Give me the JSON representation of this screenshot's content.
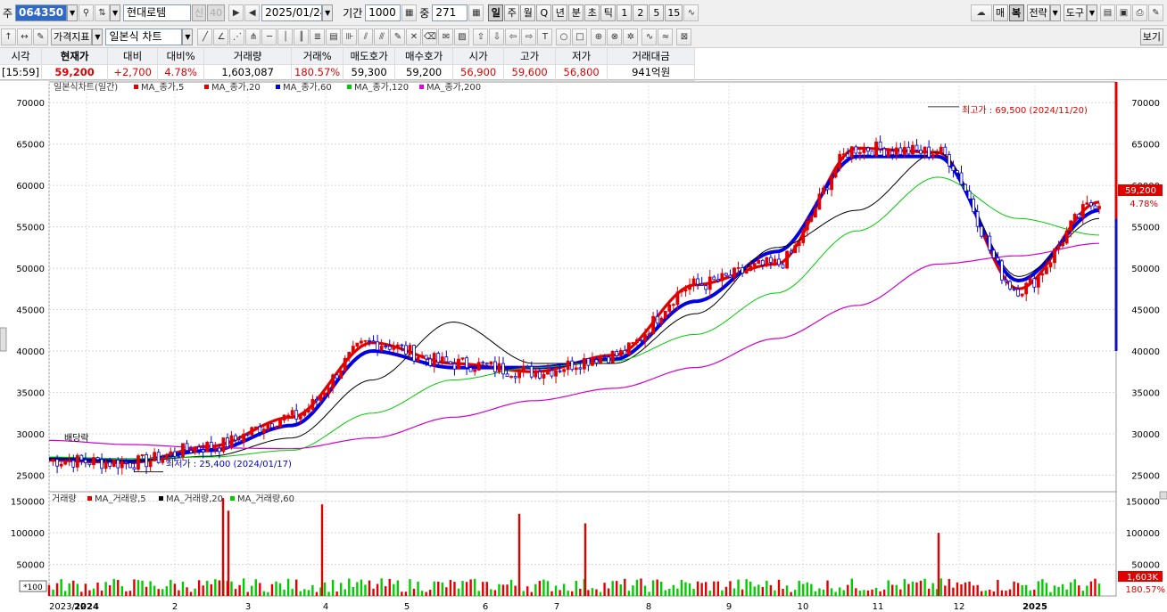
{
  "toolbar1": {
    "market_label": "주",
    "stock_code": "064350",
    "stock_name": "현대로템",
    "badge_credit": "신",
    "badge_ratio": "40",
    "date": "2025/01/24",
    "period_label": "기간",
    "period_value": "1000",
    "overlap_label": "중",
    "overlap_value": "271",
    "timeframes": [
      "일",
      "주",
      "월",
      "Q",
      "년",
      "분",
      "초",
      "틱",
      "1",
      "2",
      "5",
      "15"
    ],
    "active_timeframe": "일",
    "right_buttons": [
      "매",
      "복",
      "전략",
      "도구"
    ]
  },
  "toolbar2": {
    "time_label": "시각",
    "indicator_label": "가격지표",
    "chart_type": "일본식 차트",
    "view_label": "보기"
  },
  "quote": {
    "headers": [
      "시각",
      "현재가",
      "대비",
      "대비%",
      "거래량",
      "거래%",
      "매도호가",
      "매수호가",
      "시가",
      "고가",
      "저가",
      "거래대금"
    ],
    "values": [
      "[15:59]",
      "59,200",
      "+2,700",
      "4.78%",
      "1,603,087",
      "180.57%",
      "59,300",
      "59,200",
      "56,900",
      "59,600",
      "56,800",
      "941억원"
    ]
  },
  "price_panel": {
    "legend_title": "일본식차트(일간)",
    "legend_items": [
      "MA_종가,5",
      "MA_종가,20",
      "MA_종가,60",
      "MA_종가,120",
      "MA_종가,200"
    ],
    "legend_colors": [
      "#e00000",
      "#e00000",
      "#0000e0",
      "#00cc00",
      "#e000e0"
    ],
    "y_ticks": [
      "70000",
      "65000",
      "60000",
      "55000",
      "50000",
      "45000",
      "40000",
      "35000",
      "30000",
      "25000"
    ],
    "high_annotation": "최고가 : 69,500 (2024/11/20)",
    "low_annotation": "최저가 : 25,400 (2024/01/17)",
    "dividend_label": "배당락",
    "last_price_label": "59,200",
    "last_change_label": "4.78%"
  },
  "volume_panel": {
    "legend_title": "거래량",
    "legend_items": [
      "MA_거래량,5",
      "MA_거래량,20",
      "MA_거래량,60"
    ],
    "y_ticks": [
      "150000",
      "100000",
      "50000"
    ],
    "unit_label": "*100",
    "last_volume_label": "1,603K",
    "last_volume_pct": "180.57%"
  },
  "x_axis": {
    "labels": [
      "2023/12",
      "2024",
      "2",
      "3",
      "4",
      "5",
      "6",
      "7",
      "8",
      "9",
      "10",
      "11",
      "12",
      "2025"
    ]
  },
  "chart_data": {
    "type": "candlestick",
    "title": "일본식차트(일간)",
    "x": [
      "2023/12",
      "2024/01",
      "2024/02",
      "2024/03",
      "2024/04",
      "2024/05",
      "2024/06",
      "2024/07",
      "2024/08",
      "2024/09",
      "2024/10",
      "2024/11",
      "2024/12",
      "2025/01"
    ],
    "ylim": [
      23000,
      72500
    ],
    "series": [
      {
        "name": "MA_종가,5",
        "values": [
          26800,
          26500,
          28500,
          32000,
          41000,
          38500,
          37500,
          39500,
          48000,
          50500,
          64500,
          64000,
          47500,
          58000
        ]
      },
      {
        "name": "MA_종가,20",
        "values": [
          27000,
          26700,
          28000,
          31000,
          40000,
          38000,
          38000,
          39000,
          46000,
          52000,
          63500,
          63500,
          48500,
          57000
        ]
      },
      {
        "name": "MA_종가,60",
        "values": [
          27000,
          26700,
          27300,
          29500,
          36500,
          43500,
          38500,
          38500,
          44500,
          52500,
          57000,
          64000,
          49000,
          56000
        ]
      },
      {
        "name": "MA_종가,120",
        "values": [
          27200,
          27000,
          27200,
          28000,
          32500,
          36500,
          38000,
          38800,
          42000,
          47000,
          54500,
          61000,
          56000,
          54000
        ]
      },
      {
        "name": "MA_종가,200",
        "values": [
          29200,
          28700,
          28300,
          28200,
          29500,
          32000,
          34000,
          35500,
          38000,
          41500,
          45500,
          50500,
          51500,
          53000
        ]
      }
    ],
    "price_high": 69500,
    "price_high_date": "2024/11/20",
    "price_low": 25400,
    "price_low_date": "2024/01/17",
    "last_close": 59200,
    "volume_ylim": [
      0,
      165000
    ],
    "volume_spikes": [
      {
        "x": "2024/02",
        "value": 155000
      },
      {
        "x": "2024/03",
        "value": 135000
      },
      {
        "x": "2024/04",
        "value": 145000
      },
      {
        "x": "2024/06",
        "value": 130000
      },
      {
        "x": "2024/07",
        "value": 115000
      },
      {
        "x": "2024/11",
        "value": 100000
      }
    ]
  },
  "colors": {
    "up": "#e00000",
    "down": "#0000d0",
    "ma5": "#e00000",
    "ma20": "#0000e0",
    "ma60": "#000000",
    "ma120": "#00cc00",
    "ma200": "#d000d0",
    "volume_up": "#00cc00",
    "volume_down": "#e00000"
  }
}
